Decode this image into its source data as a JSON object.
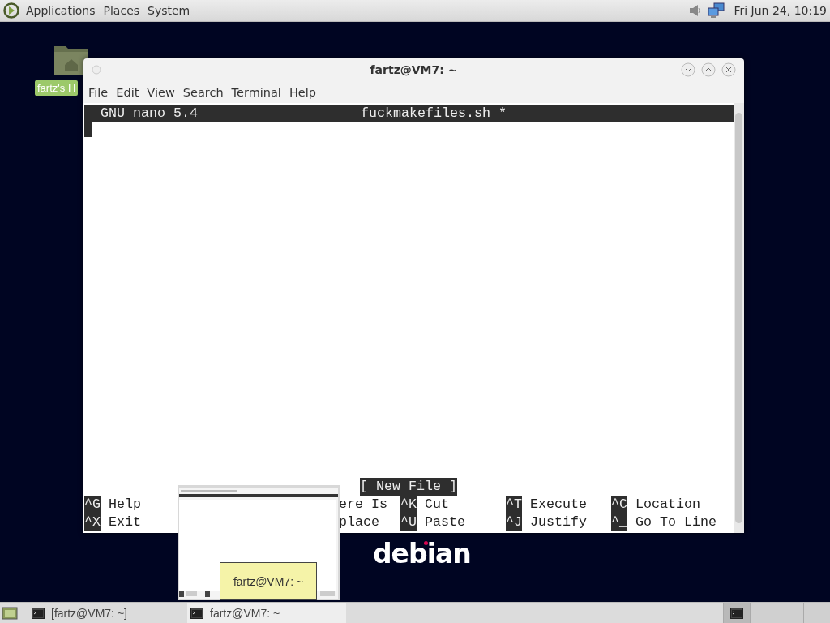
{
  "top_panel": {
    "menus": [
      "Applications",
      "Places",
      "System"
    ],
    "clock": "Fri Jun 24, 10:19"
  },
  "desktop": {
    "icon_label": "fartz's H",
    "logo_text": "debian"
  },
  "window": {
    "title": "fartz@VM7: ~",
    "menu": [
      "File",
      "Edit",
      "View",
      "Search",
      "Terminal",
      "Help"
    ],
    "nano": {
      "version": "GNU nano 5.4",
      "filename": "fuckmakefiles.sh *",
      "status": "[ New File ]",
      "columns": [
        {
          "kind": "full",
          "top": {
            "key": "^G",
            "label": "Help"
          },
          "bottom": {
            "key": "^X",
            "label": "Exit"
          }
        },
        {
          "kind": "partial",
          "top": {
            "label": "ere Is"
          },
          "bottom": {
            "label": "place"
          }
        },
        {
          "kind": "full",
          "top": {
            "key": "^K",
            "label": "Cut"
          },
          "bottom": {
            "key": "^U",
            "label": "Paste"
          }
        },
        {
          "kind": "full",
          "top": {
            "key": "^T",
            "label": "Execute"
          },
          "bottom": {
            "key": "^J",
            "label": "Justify"
          }
        },
        {
          "kind": "full",
          "top": {
            "key": "^C",
            "label": "Location"
          },
          "bottom": {
            "key": "^_",
            "label": "Go To Line"
          }
        }
      ]
    }
  },
  "tooltip": "fartz@VM7: ~",
  "taskbar": {
    "tasks": [
      {
        "label": "[fartz@VM7: ~]",
        "selected": false
      },
      {
        "label": "fartz@VM7: ~",
        "selected": true
      }
    ],
    "workspaces": [
      {
        "selected": true
      },
      {
        "selected": false
      },
      {
        "selected": false
      },
      {
        "selected": false
      }
    ]
  }
}
